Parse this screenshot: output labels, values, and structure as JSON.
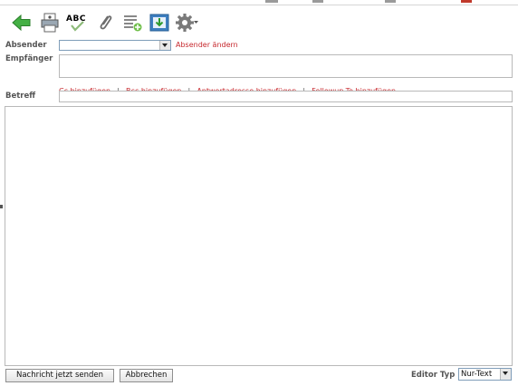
{
  "toolbar": {
    "icons": [
      "back-arrow-icon",
      "print-icon",
      "spellcheck-icon",
      "attachment-icon",
      "add-notes-icon",
      "save-draft-icon",
      "settings-gear-icon"
    ],
    "spellcheck_text": "ABC"
  },
  "form": {
    "sender_label": "Absender",
    "sender_value": "",
    "change_sender_link": "Absender ändern",
    "recipient_label": "Empfänger",
    "recipient_value": "",
    "links": {
      "cc": "Cc hinzufügen",
      "bcc": "Bcc hinzufügen",
      "reply_to": "Antwortadresse hinzufügen",
      "followup_to": "Followup-To hinzufügen"
    },
    "separator": "|",
    "subject_label": "Betreff",
    "subject_value": "",
    "body_value": ""
  },
  "footer": {
    "send_button": "Nachricht jetzt senden",
    "cancel_button": "Abbrechen",
    "editor_type_label": "Editor Typ",
    "editor_type_value": "Nur-Text"
  },
  "colors": {
    "link_red": "#c6282d",
    "label_gray": "#555555",
    "border": "#b9b9b9",
    "back_arrow_green": "#3aa63a"
  }
}
